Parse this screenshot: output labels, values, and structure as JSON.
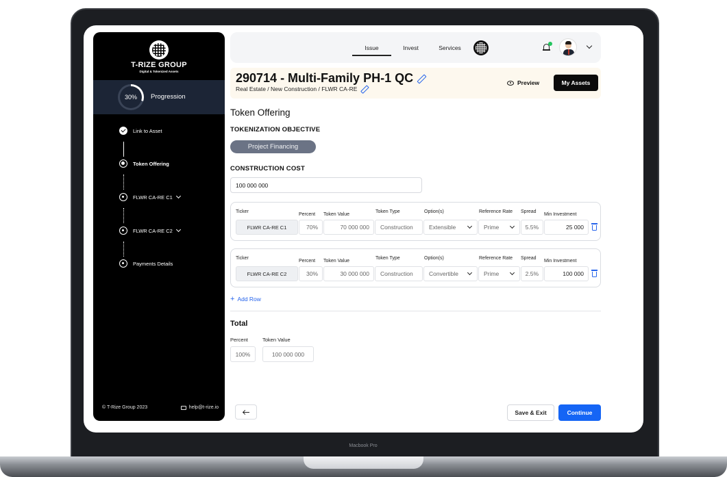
{
  "device": {
    "label": "Macbook Pro"
  },
  "sidebar": {
    "brand": {
      "name": "T-RIZE GROUP",
      "tagline": "Digital & Tokenized Assets"
    },
    "progress": {
      "percent_label": "30%",
      "percent_value": 30,
      "label": "Progression"
    },
    "steps": [
      {
        "label": "Link to Asset",
        "state": "done",
        "expandable": false
      },
      {
        "label": "Token Offering",
        "state": "current",
        "expandable": false
      },
      {
        "label": "FLWR CA-RE C1",
        "state": "todo",
        "expandable": true
      },
      {
        "label": "FLWR CA-RE C2",
        "state": "todo",
        "expandable": true
      },
      {
        "label": "Payments Details",
        "state": "todo",
        "expandable": false
      }
    ],
    "footer": {
      "copyright": "© T-Rize Group 2023",
      "email": "help@t-rize.io"
    }
  },
  "topbar": {
    "tabs": [
      {
        "label": "Issue",
        "active": true
      },
      {
        "label": "Invest",
        "active": false
      },
      {
        "label": "Services",
        "active": false
      }
    ],
    "notification_dot_color": "#22c55e"
  },
  "asset": {
    "title": "290714 - Multi-Family PH-1 QC",
    "breadcrumb": "Real Estate / New Construction / FLWR CA-RE",
    "preview_label": "Preview",
    "my_assets_label": "My Assets"
  },
  "offering": {
    "section_title": "Token Offering",
    "objective_label": "TOKENIZATION OBJECTIVE",
    "objective_value": "Project Financing",
    "cost_label": "CONSTRUCTION COST",
    "cost_value": "100 000 000",
    "columns": {
      "ticker": "Ticker",
      "percent": "Percent",
      "token_value": "Token Value",
      "token_type": "Token Type",
      "options": "Option(s)",
      "reference_rate": "Reference Rate",
      "spread": "Spread",
      "min_investment": "Min Investment"
    },
    "rows": [
      {
        "ticker": "FLWR CA-RE C1",
        "percent": "70%",
        "token_value": "70 000 000",
        "token_type": "Construction",
        "option": "Extensible",
        "reference_rate": "Prime",
        "spread": "5.5%",
        "min_investment": "25 000"
      },
      {
        "ticker": "FLWR CA-RE C2",
        "percent": "30%",
        "token_value": "30 000 000",
        "token_type": "Construction",
        "option": "Convertible",
        "reference_rate": "Prime",
        "spread": "2.5%",
        "min_investment": "100 000"
      }
    ],
    "add_row_label": "Add Row"
  },
  "total": {
    "title": "Total",
    "percent_label": "Percent",
    "token_value_label": "Token Value",
    "percent_value": "100%",
    "token_value": "100 000 000"
  },
  "actions": {
    "save_exit_label": "Save & Exit",
    "continue_label": "Continue"
  },
  "colors": {
    "accent": "#1565f5",
    "sidebar_bg": "#000000",
    "pill_bg": "#6b7385",
    "banner_bg": "#fdf8ee"
  }
}
